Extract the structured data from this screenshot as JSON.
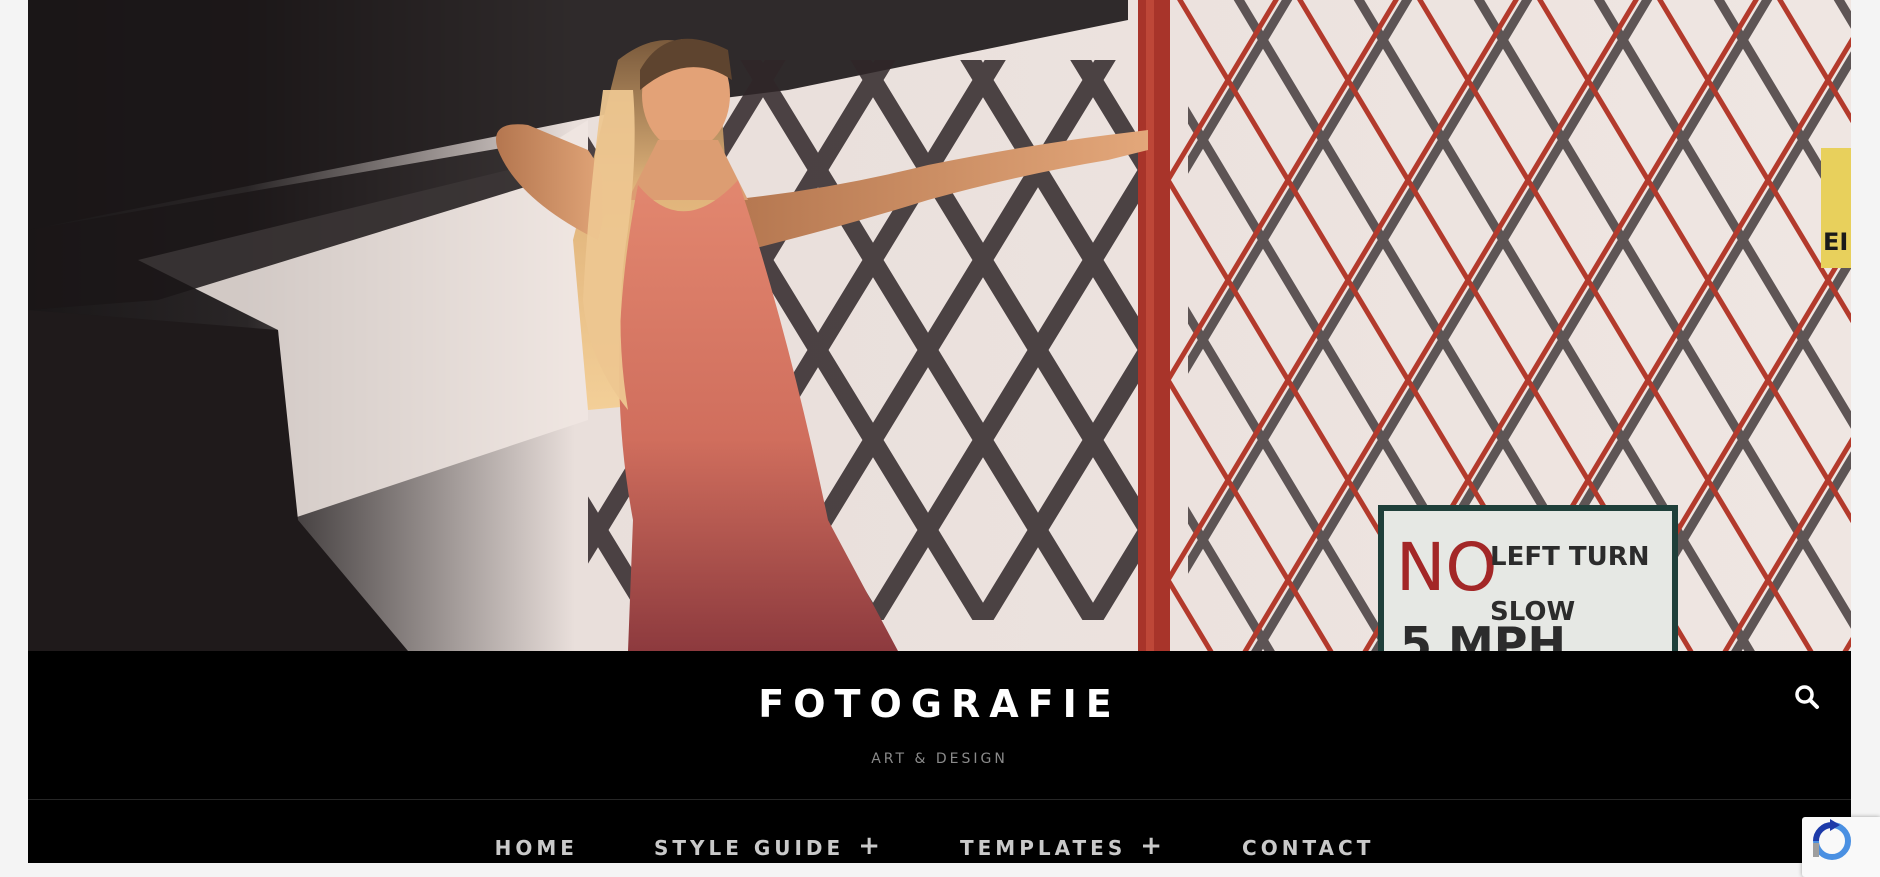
{
  "site": {
    "title": "FOTOGRAFIE",
    "tagline": "ART & DESIGN"
  },
  "hero": {
    "sign_line1_big": "NO",
    "sign_line1_small": "LEFT TURN",
    "sign_line2": "SLOW",
    "sign_line3": "5 MPH",
    "side_sign_text": "EI"
  },
  "nav": {
    "items": [
      {
        "label": "HOME",
        "has_submenu": false
      },
      {
        "label": "STYLE GUIDE",
        "has_submenu": true
      },
      {
        "label": "TEMPLATES",
        "has_submenu": true
      },
      {
        "label": "CONTACT",
        "has_submenu": false
      }
    ],
    "submenu_symbol": "+"
  },
  "icons": {
    "search": "search-icon",
    "recaptcha": "recaptcha-icon"
  },
  "colors": {
    "header_bg": "#000000",
    "title": "#ffffff",
    "tagline": "#8a8a8a",
    "nav_text": "#c9c9c9"
  }
}
